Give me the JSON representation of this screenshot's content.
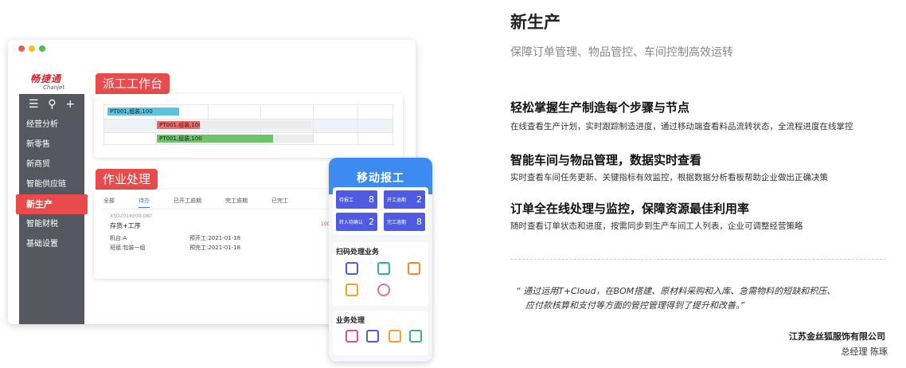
{
  "app": {
    "logo_cn": "畅捷通",
    "logo_en": "Chanjet"
  },
  "sidebar": {
    "tools": [
      "☰",
      "⚲",
      "+"
    ],
    "items": [
      {
        "label": "经营分析"
      },
      {
        "label": "新零售"
      },
      {
        "label": "新商贸"
      },
      {
        "label": "智能供应链"
      },
      {
        "label": "新生产",
        "active": true
      },
      {
        "label": "智能财税"
      },
      {
        "label": "基础设置"
      }
    ]
  },
  "dispatch": {
    "title": "派工工作台",
    "bars": [
      {
        "label": "PT001,组装,100",
        "color": "#5bc3de"
      },
      {
        "label": "PT001,组装,100",
        "color": "#f06a6a"
      },
      {
        "label": "PT001,组装,100",
        "color": "#6cc36a"
      }
    ]
  },
  "jobs": {
    "title": "作业处理",
    "tabs": [
      "全部",
      "待办",
      "已开工逾期",
      "完工逾期",
      "已完工"
    ],
    "active_tab": "待办",
    "order_no": "XSD2014000-080",
    "order_title": "存货+工序",
    "order_count": "100",
    "machine": "机台:A",
    "team": "班组:包装一组",
    "plan_start": "预开工:2021-01-18",
    "plan_end": "预完工:2021-01-18"
  },
  "mobile": {
    "title": "移动报工",
    "stats": [
      {
        "label": "待报工",
        "value": "8"
      },
      {
        "label": "开工逾期",
        "value": "2"
      },
      {
        "label": "转入待确认",
        "value": "2"
      },
      {
        "label": "完工逾期",
        "value": "8"
      }
    ],
    "scan_title": "扫码处理业务",
    "biz_title": "业务处理",
    "accent": "#3d8bf0"
  },
  "content": {
    "title": "新生产",
    "subtitle": "保障订单管理、物品管控、车间控制高效运转",
    "features": [
      {
        "heading": "轻松掌握生产制造每个步骤与节点",
        "desc": "在线查看生产计划，实时跟踪制造进度，通过移动端查看料品流转状态，全流程进度在线掌控"
      },
      {
        "heading": "智能车间与物品管理，数据实时查看",
        "desc": "实时查看车间任务更新、关键指标有效监控，根据数据分析看板帮助企业做出正确决策"
      },
      {
        "heading": "订单全在线处理与监控，保障资源最佳利用率",
        "desc": "随时查看订单状态和进度，按需同步到生产车间工人列表，企业可调整经营策略"
      }
    ],
    "quote_line1": "“ 通过运用T+Cloud，在BOM搭建、原材料采购和入库、急需物料的短缺和积压、",
    "quote_line2": "应付款核算和支付等方面的管控管理得到了提升和改善。”",
    "company": "江苏金丝狐服饰有限公司",
    "person": "总经理 陈琢"
  }
}
